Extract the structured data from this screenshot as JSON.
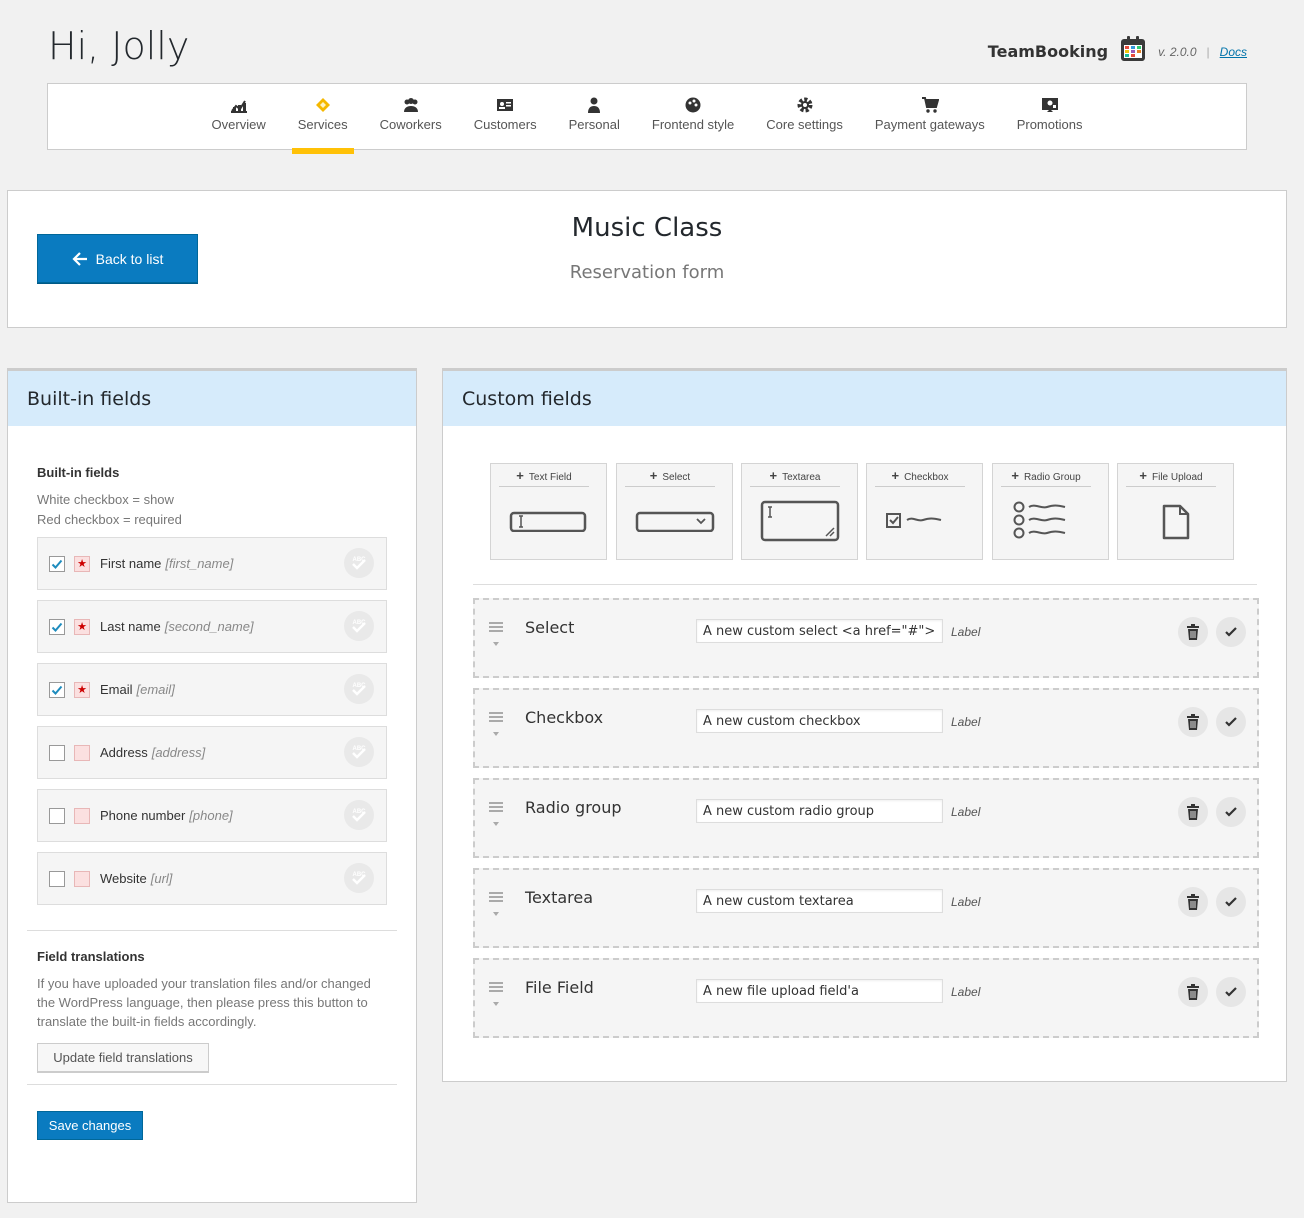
{
  "greeting": "Hi, Jolly",
  "brand": {
    "name": "TeamBooking",
    "version": "v. 2.0.0",
    "separator": "|",
    "docs": "Docs"
  },
  "nav": [
    {
      "label": "Overview",
      "icon": "chart-icon"
    },
    {
      "label": "Services",
      "icon": "ticket-icon",
      "active": true
    },
    {
      "label": "Coworkers",
      "icon": "group-icon"
    },
    {
      "label": "Customers",
      "icon": "id-card-icon"
    },
    {
      "label": "Personal",
      "icon": "person-icon"
    },
    {
      "label": "Frontend style",
      "icon": "palette-icon"
    },
    {
      "label": "Core settings",
      "icon": "gear-icon"
    },
    {
      "label": "Payment gateways",
      "icon": "cart-icon"
    },
    {
      "label": "Promotions",
      "icon": "promotion-icon"
    }
  ],
  "service": {
    "back_label": "Back to list",
    "title": "Music Class",
    "subtitle": "Reservation form"
  },
  "builtin": {
    "panel_title": "Built-in fields",
    "section_title": "Built-in fields",
    "hint1": "White checkbox = show",
    "hint2": "Red checkbox = required",
    "fields": [
      {
        "label": "First name",
        "key": "[first_name]",
        "show": true,
        "required": true
      },
      {
        "label": "Last name",
        "key": "[second_name]",
        "show": true,
        "required": true
      },
      {
        "label": "Email",
        "key": "[email]",
        "show": true,
        "required": true
      },
      {
        "label": "Address",
        "key": "[address]",
        "show": false,
        "required": false
      },
      {
        "label": "Phone number",
        "key": "[phone]",
        "show": false,
        "required": false
      },
      {
        "label": "Website",
        "key": "[url]",
        "show": false,
        "required": false
      }
    ],
    "translations_title": "Field translations",
    "translations_text": "If you have uploaded your translation files and/or changed the WordPress language, then please press this button to translate the built-in fields accordingly.",
    "update_label": "Update field translations",
    "save_label": "Save changes"
  },
  "custom": {
    "panel_title": "Custom fields",
    "add_buttons": [
      "Text Field",
      "Select",
      "Textarea",
      "Checkbox",
      "Radio Group",
      "File Upload"
    ],
    "fields": [
      {
        "title": "Select",
        "value": "A new custom select <a href=\"#\">ciao</a>",
        "label": "Label"
      },
      {
        "title": "Checkbox",
        "value": "A new custom checkbox",
        "label": "Label"
      },
      {
        "title": "Radio group",
        "value": "A new custom radio group",
        "label": "Label"
      },
      {
        "title": "Textarea",
        "value": "A new custom textarea",
        "label": "Label"
      },
      {
        "title": "File Field",
        "value": "A new file upload field'a",
        "label": "Label"
      }
    ]
  },
  "colors": {
    "accent": "#0a7bc0",
    "active_tab": "#ffc107",
    "panel_header": "#d6ebfb"
  }
}
